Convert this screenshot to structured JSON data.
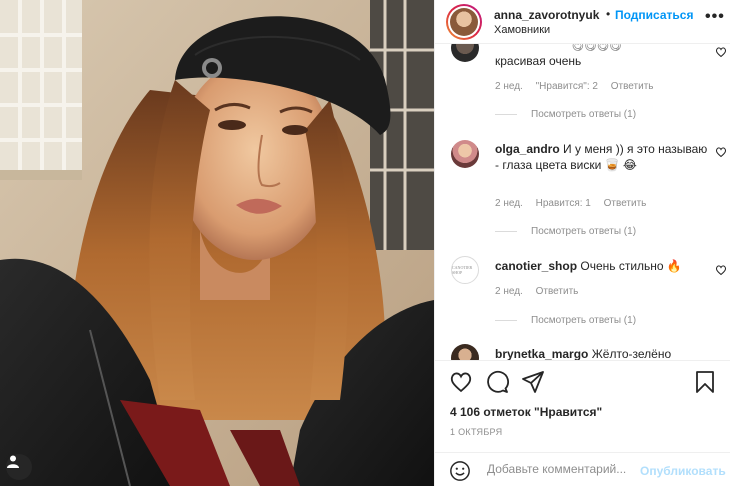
{
  "header": {
    "username": "anna_zavorotnyuk",
    "dot": "•",
    "follow_label": "Подписаться",
    "location": "Хамовники",
    "more": "•••"
  },
  "comments": [
    {
      "author": "",
      "text": "красивая очень",
      "time": "2 нед.",
      "likes": "\"Нравится\": 2",
      "reply": "Ответить",
      "view_replies": "Посмотреть ответы (1)"
    },
    {
      "author": "olga_andro",
      "text": "И у меня )) я это называю - глаза цвета виски 🥃 😂",
      "time": "2 нед.",
      "likes": "Нравится: 1",
      "reply": "Ответить",
      "view_replies": "Посмотреть ответы (1)"
    },
    {
      "author": "canotier_shop",
      "text": "Очень стильно 🔥",
      "time": "2 нед.",
      "reply": "Ответить",
      "view_replies": "Посмотреть ответы (1)"
    },
    {
      "author": "brynetka_margo",
      "text": "Жёлто-зелёно"
    }
  ],
  "actions": {
    "likes": "4 106 отметок \"Нравится\"",
    "date": "1 ОКТЯБРЯ"
  },
  "add_comment": {
    "placeholder": "Добавьте комментарий...",
    "publish": "Опубликовать"
  },
  "colors": {
    "link": "#0095f6",
    "publish_disabled": "#b2dffc",
    "muted": "#8e8e8e",
    "text": "#262626"
  },
  "icons": [
    "heart-icon",
    "comment-icon",
    "share-icon",
    "bookmark-icon",
    "emoji-icon",
    "user-tag-icon",
    "more-icon"
  ]
}
